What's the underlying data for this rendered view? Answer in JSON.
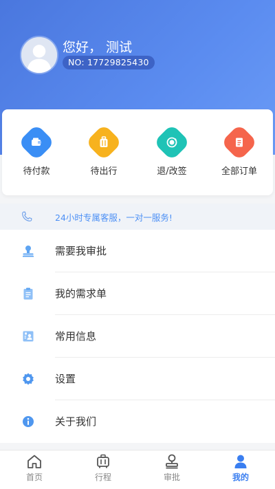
{
  "header": {
    "greeting": "您好， 测试",
    "user_no": "NO: 17729825430"
  },
  "orders": [
    {
      "label": "待付款",
      "icon": "wallet-icon",
      "color": "#3a8ef5"
    },
    {
      "label": "待出行",
      "icon": "luggage-icon",
      "color": "#f7b21e"
    },
    {
      "label": "退/改签",
      "icon": "refund-icon",
      "color": "#1fc3b6"
    },
    {
      "label": "全部订单",
      "icon": "order-list-icon",
      "color": "#f5654c"
    }
  ],
  "service": {
    "text": "24小时专属客服，一对一服务!",
    "icon": "phone-icon"
  },
  "menu": [
    {
      "label": "需要我审批",
      "icon": "stamp-icon"
    },
    {
      "label": "我的需求单",
      "icon": "clipboard-icon"
    },
    {
      "label": "常用信息",
      "icon": "contact-card-icon"
    },
    {
      "label": "设置",
      "icon": "gear-icon"
    },
    {
      "label": "关于我们",
      "icon": "info-icon"
    }
  ],
  "tabbar": [
    {
      "label": "首页",
      "icon": "home-icon",
      "active": false
    },
    {
      "label": "行程",
      "icon": "trip-icon",
      "active": false
    },
    {
      "label": "审批",
      "icon": "approval-icon",
      "active": false
    },
    {
      "label": "我的",
      "icon": "profile-icon",
      "active": true
    }
  ],
  "colors": {
    "header_gradient_start": "#4a77de",
    "header_gradient_end": "#6a9bf6",
    "accent": "#3a7ef0",
    "service_text": "#4d90f5"
  }
}
